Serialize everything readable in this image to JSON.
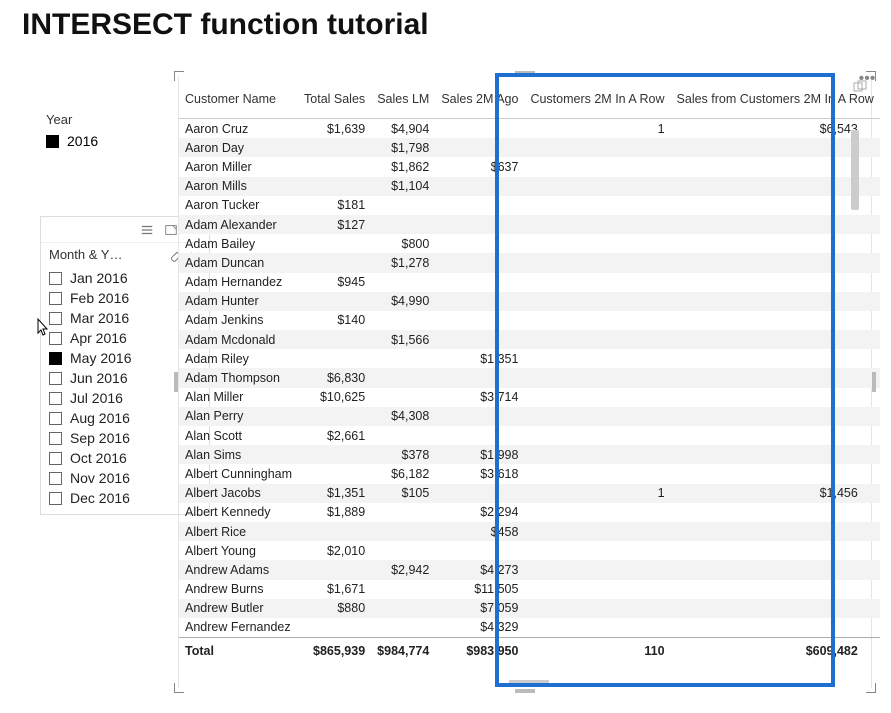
{
  "title": "INTERSECT function tutorial",
  "yearSlicer": {
    "label": "Year",
    "items": [
      {
        "label": "2016",
        "checked": true
      }
    ]
  },
  "monthSlicer": {
    "header": "Month & Y…",
    "items": [
      {
        "label": "Jan 2016",
        "checked": false
      },
      {
        "label": "Feb 2016",
        "checked": false
      },
      {
        "label": "Mar 2016",
        "checked": false
      },
      {
        "label": "Apr 2016",
        "checked": false
      },
      {
        "label": "May 2016",
        "checked": true
      },
      {
        "label": "Jun 2016",
        "checked": false
      },
      {
        "label": "Jul 2016",
        "checked": false
      },
      {
        "label": "Aug 2016",
        "checked": false
      },
      {
        "label": "Sep 2016",
        "checked": false
      },
      {
        "label": "Oct 2016",
        "checked": false
      },
      {
        "label": "Nov 2016",
        "checked": false
      },
      {
        "label": "Dec 2016",
        "checked": false
      }
    ]
  },
  "table": {
    "columns": [
      "Customer Name",
      "Total Sales",
      "Sales LM",
      "Sales 2M Ago",
      "Customers 2M In A Row",
      "Sales from Customers 2M In A Row"
    ],
    "rows": [
      {
        "name": "Aaron Cruz",
        "totalSales": "$1,639",
        "salesLM": "$4,904",
        "sales2M": "",
        "c2m": "1",
        "s2m": "$6,543"
      },
      {
        "name": "Aaron Day",
        "totalSales": "",
        "salesLM": "$1,798",
        "sales2M": "",
        "c2m": "",
        "s2m": ""
      },
      {
        "name": "Aaron Miller",
        "totalSales": "",
        "salesLM": "$1,862",
        "sales2M": "$637",
        "c2m": "",
        "s2m": ""
      },
      {
        "name": "Aaron Mills",
        "totalSales": "",
        "salesLM": "$1,104",
        "sales2M": "",
        "c2m": "",
        "s2m": ""
      },
      {
        "name": "Aaron Tucker",
        "totalSales": "$181",
        "salesLM": "",
        "sales2M": "",
        "c2m": "",
        "s2m": ""
      },
      {
        "name": "Adam Alexander",
        "totalSales": "$127",
        "salesLM": "",
        "sales2M": "",
        "c2m": "",
        "s2m": ""
      },
      {
        "name": "Adam Bailey",
        "totalSales": "",
        "salesLM": "$800",
        "sales2M": "",
        "c2m": "",
        "s2m": ""
      },
      {
        "name": "Adam Duncan",
        "totalSales": "",
        "salesLM": "$1,278",
        "sales2M": "",
        "c2m": "",
        "s2m": ""
      },
      {
        "name": "Adam Hernandez",
        "totalSales": "$945",
        "salesLM": "",
        "sales2M": "",
        "c2m": "",
        "s2m": ""
      },
      {
        "name": "Adam Hunter",
        "totalSales": "",
        "salesLM": "$4,990",
        "sales2M": "",
        "c2m": "",
        "s2m": ""
      },
      {
        "name": "Adam Jenkins",
        "totalSales": "$140",
        "salesLM": "",
        "sales2M": "",
        "c2m": "",
        "s2m": ""
      },
      {
        "name": "Adam Mcdonald",
        "totalSales": "",
        "salesLM": "$1,566",
        "sales2M": "",
        "c2m": "",
        "s2m": ""
      },
      {
        "name": "Adam Riley",
        "totalSales": "",
        "salesLM": "",
        "sales2M": "$1,351",
        "c2m": "",
        "s2m": ""
      },
      {
        "name": "Adam Thompson",
        "totalSales": "$6,830",
        "salesLM": "",
        "sales2M": "",
        "c2m": "",
        "s2m": ""
      },
      {
        "name": "Alan Miller",
        "totalSales": "$10,625",
        "salesLM": "",
        "sales2M": "$3,714",
        "c2m": "",
        "s2m": ""
      },
      {
        "name": "Alan Perry",
        "totalSales": "",
        "salesLM": "$4,308",
        "sales2M": "",
        "c2m": "",
        "s2m": ""
      },
      {
        "name": "Alan Scott",
        "totalSales": "$2,661",
        "salesLM": "",
        "sales2M": "",
        "c2m": "",
        "s2m": ""
      },
      {
        "name": "Alan Sims",
        "totalSales": "",
        "salesLM": "$378",
        "sales2M": "$1,998",
        "c2m": "",
        "s2m": ""
      },
      {
        "name": "Albert Cunningham",
        "totalSales": "",
        "salesLM": "$6,182",
        "sales2M": "$3,618",
        "c2m": "",
        "s2m": ""
      },
      {
        "name": "Albert Jacobs",
        "totalSales": "$1,351",
        "salesLM": "$105",
        "sales2M": "",
        "c2m": "1",
        "s2m": "$1,456"
      },
      {
        "name": "Albert Kennedy",
        "totalSales": "$1,889",
        "salesLM": "",
        "sales2M": "$2,294",
        "c2m": "",
        "s2m": ""
      },
      {
        "name": "Albert Rice",
        "totalSales": "",
        "salesLM": "",
        "sales2M": "$458",
        "c2m": "",
        "s2m": ""
      },
      {
        "name": "Albert Young",
        "totalSales": "$2,010",
        "salesLM": "",
        "sales2M": "",
        "c2m": "",
        "s2m": ""
      },
      {
        "name": "Andrew Adams",
        "totalSales": "",
        "salesLM": "$2,942",
        "sales2M": "$4,273",
        "c2m": "",
        "s2m": ""
      },
      {
        "name": "Andrew Burns",
        "totalSales": "$1,671",
        "salesLM": "",
        "sales2M": "$11,505",
        "c2m": "",
        "s2m": ""
      },
      {
        "name": "Andrew Butler",
        "totalSales": "$880",
        "salesLM": "",
        "sales2M": "$7,059",
        "c2m": "",
        "s2m": ""
      },
      {
        "name": "Andrew Fernandez",
        "totalSales": "",
        "salesLM": "",
        "sales2M": "$4,329",
        "c2m": "",
        "s2m": ""
      }
    ],
    "total": {
      "label": "Total",
      "totalSales": "$865,939",
      "salesLM": "$984,774",
      "sales2M": "$983,950",
      "c2m": "110",
      "s2m": "$609,482"
    }
  }
}
